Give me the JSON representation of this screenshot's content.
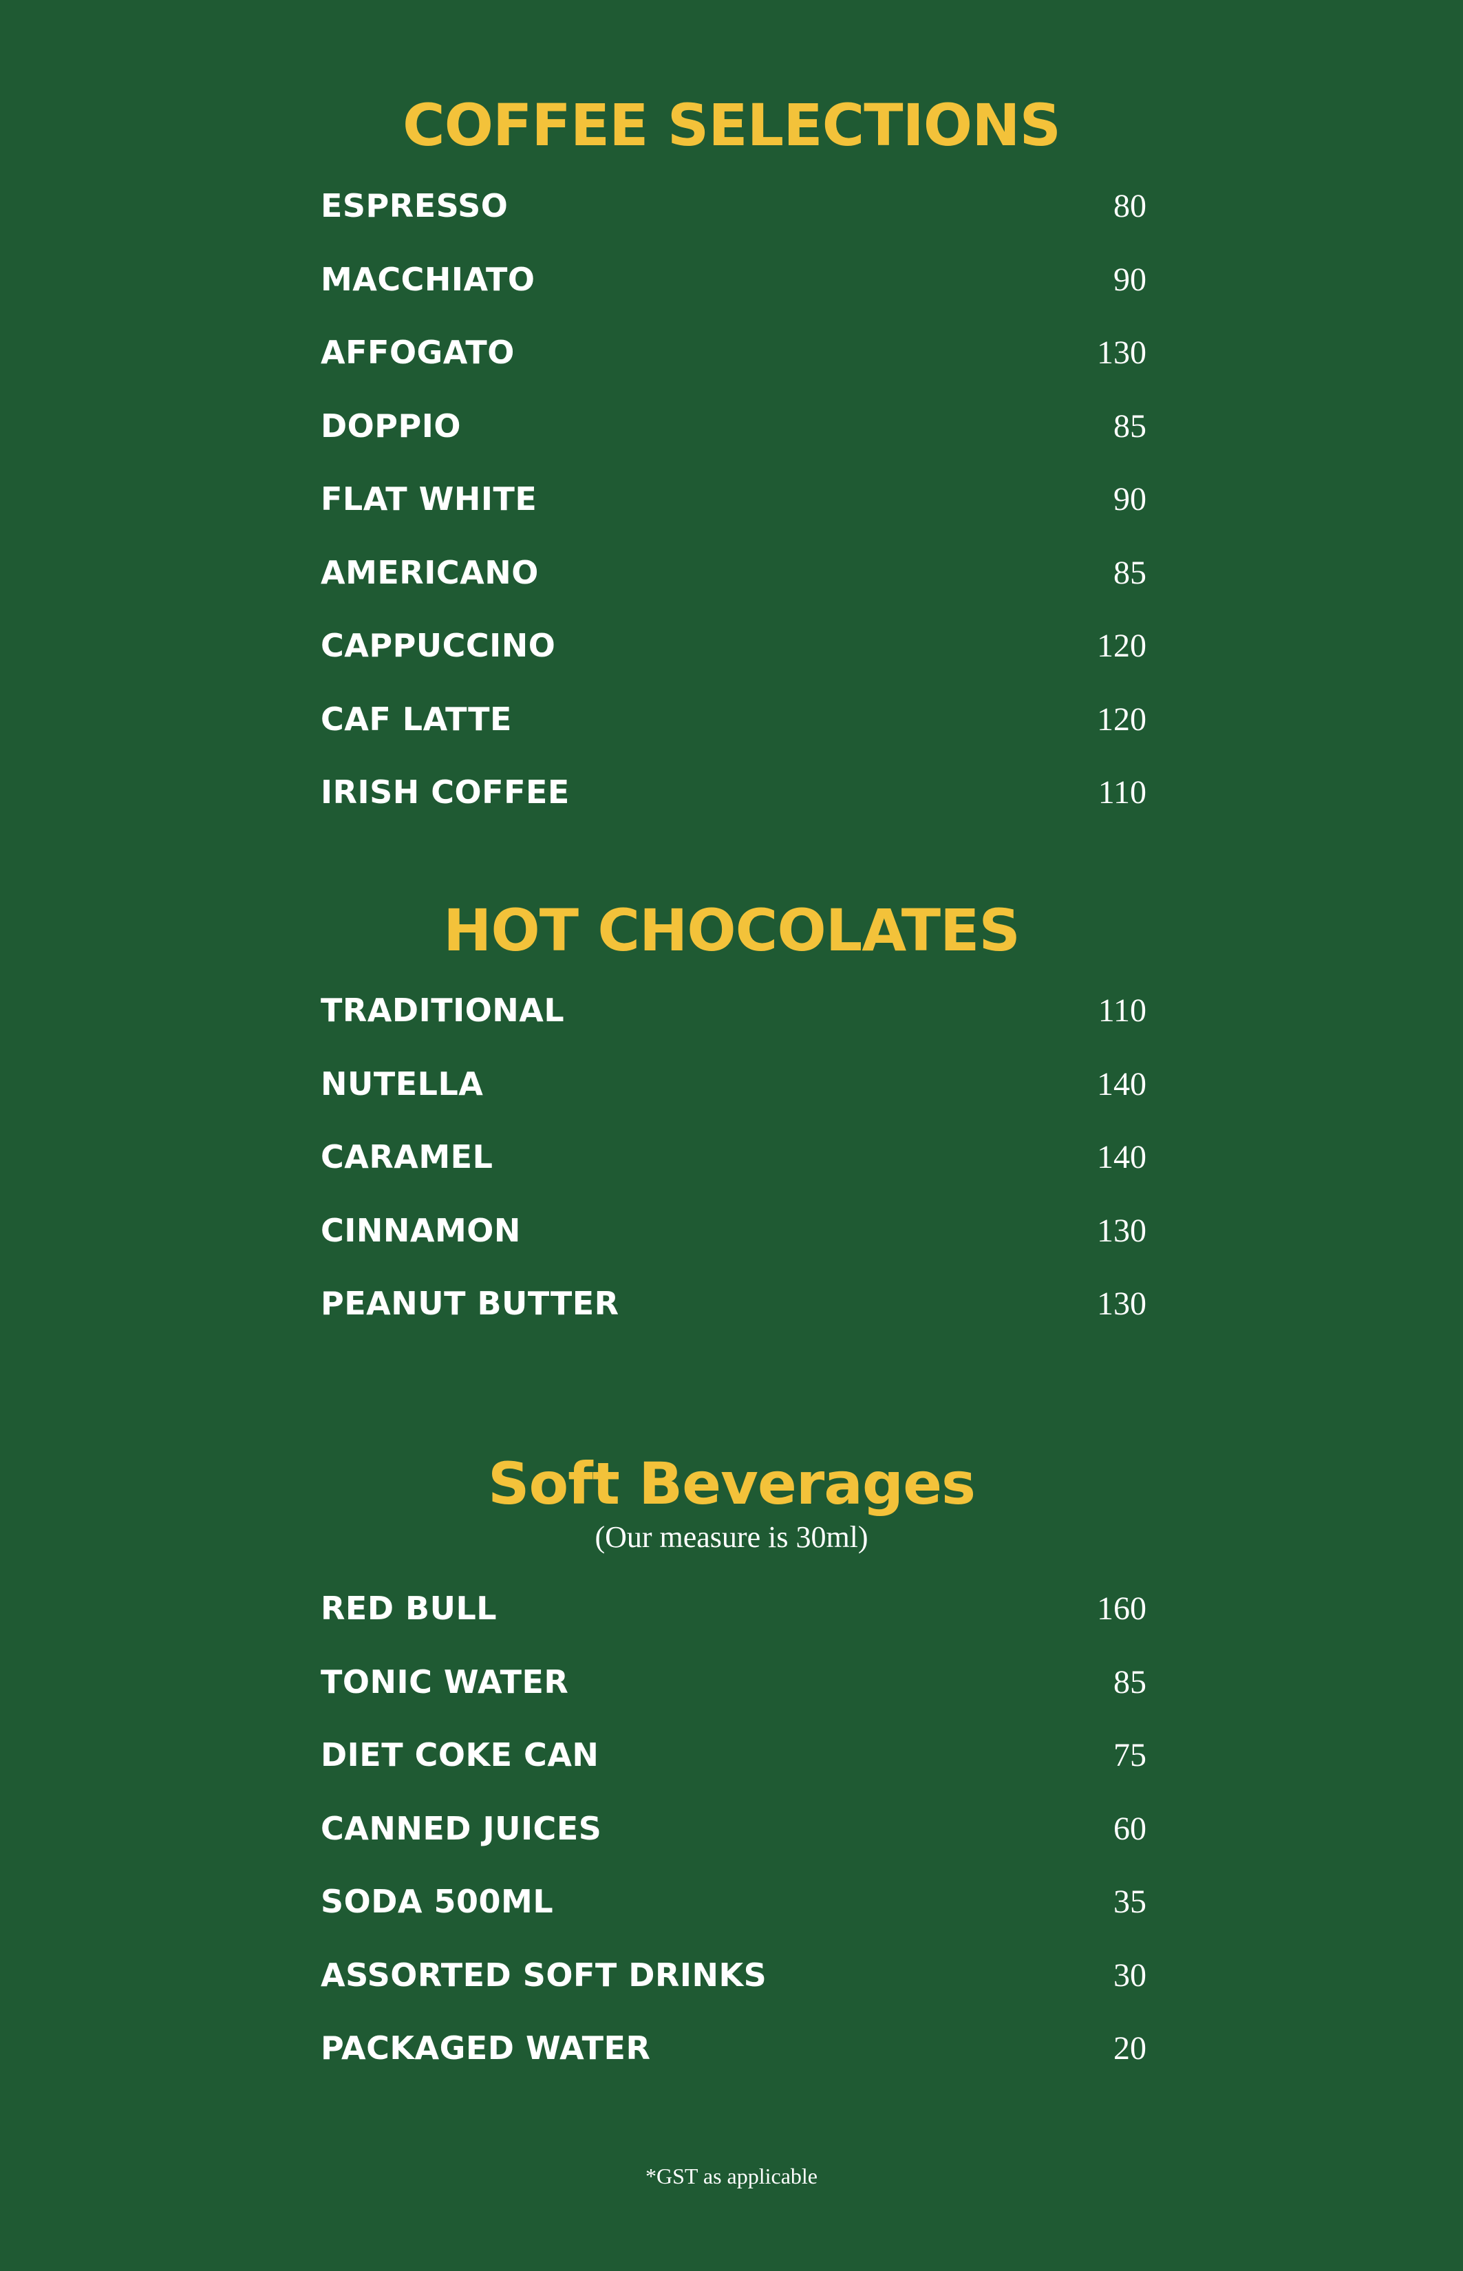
{
  "sections": [
    {
      "title": "COFFEE SELECTIONS",
      "subtitle": "",
      "items": [
        {
          "name": "ESPRESSO",
          "price": "80"
        },
        {
          "name": "MACCHIATO",
          "price": "90"
        },
        {
          "name": "AFFOGATO",
          "price": "130"
        },
        {
          "name": "DOPPIO",
          "price": "85"
        },
        {
          "name": "FLAT WHITE",
          "price": "90"
        },
        {
          "name": "AMERICANO",
          "price": "85"
        },
        {
          "name": "CAPPUCCINO",
          "price": "120"
        },
        {
          "name": "CAF LATTE",
          "price": "120"
        },
        {
          "name": "IRISH COFFEE",
          "price": "110"
        }
      ]
    },
    {
      "title": "HOT CHOCOLATES",
      "subtitle": "",
      "items": [
        {
          "name": "TRADITIONAL",
          "price": "110"
        },
        {
          "name": "NUTELLA",
          "price": "140"
        },
        {
          "name": "CARAMEL",
          "price": "140"
        },
        {
          "name": "CINNAMON",
          "price": "130"
        },
        {
          "name": "PEANUT BUTTER",
          "price": "130"
        }
      ]
    },
    {
      "title": "Soft Beverages",
      "subtitle": "(Our measure is 30ml)",
      "items": [
        {
          "name": "RED BULL",
          "price": "160"
        },
        {
          "name": "TONIC WATER",
          "price": "85"
        },
        {
          "name": "DIET COKE CAN",
          "price": "75"
        },
        {
          "name": "CANNED JUICES",
          "price": "60"
        },
        {
          "name": "SODA 500ML",
          "price": "35"
        },
        {
          "name": "ASSORTED SOFT DRINKS",
          "price": "30"
        },
        {
          "name": "PACKAGED WATER",
          "price": "20"
        }
      ]
    }
  ],
  "footnote": "*GST as applicable",
  "colors": {
    "background": "#1f5a33",
    "heading": "#f3c23a",
    "text": "#ffffff"
  }
}
